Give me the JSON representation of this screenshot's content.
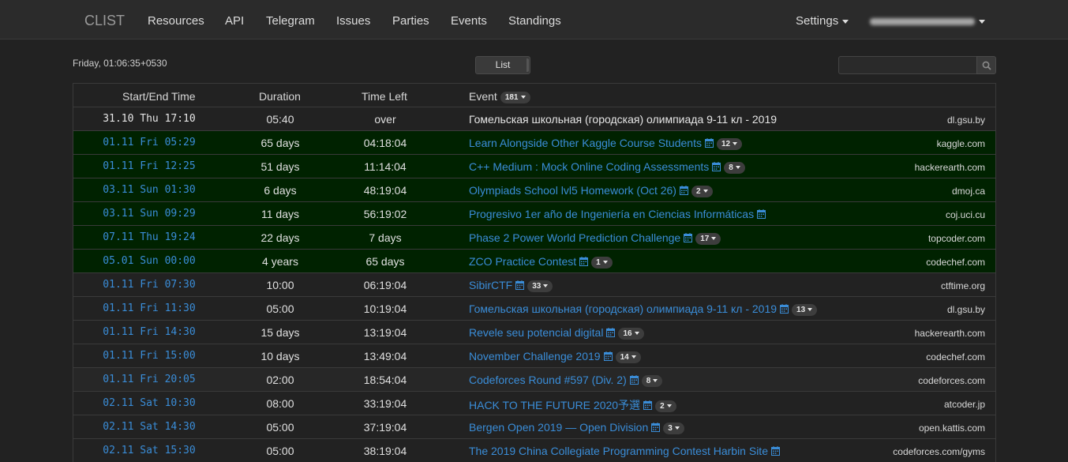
{
  "navbar": {
    "brand": "CLIST",
    "links": [
      "Resources",
      "API",
      "Telegram",
      "Issues",
      "Parties",
      "Events",
      "Standings"
    ],
    "settings_label": "Settings"
  },
  "toolbar": {
    "clock": "Friday, 01:06:35+0530",
    "view_label": "List",
    "search_placeholder": ""
  },
  "table": {
    "headers": {
      "start": "Start/End Time",
      "duration": "Duration",
      "time_left": "Time Left",
      "event": "Event",
      "event_count": "181"
    },
    "rows": [
      {
        "start": "31.10 Thu 17:10",
        "duration": "05:40",
        "left": "over",
        "title": "Гомельская школьная (городская) олимпиада 9-11 кл - 2019",
        "badge": "",
        "calendar": false,
        "host": "dl.gsu.by"
      },
      {
        "start": "01.11 Fri 05:29",
        "duration": "65 days",
        "left": "04:18:04",
        "title": "Learn Alongside Other Kaggle Course Students",
        "badge": "12",
        "calendar": true,
        "host": "kaggle.com"
      },
      {
        "start": "01.11 Fri 12:25",
        "duration": "51 days",
        "left": "11:14:04",
        "title": "C++ Medium : Mock Online Coding Assessments",
        "badge": "8",
        "calendar": true,
        "host": "hackerearth.com"
      },
      {
        "start": "03.11 Sun 01:30",
        "duration": "6 days",
        "left": "48:19:04",
        "title": "Olympiads School lvl5 Homework (Oct 26)",
        "badge": "2",
        "calendar": true,
        "host": "dmoj.ca"
      },
      {
        "start": "03.11 Sun 09:29",
        "duration": "11 days",
        "left": "56:19:02",
        "title": "Progresivo 1er año de Ingeniería en Ciencias Informáticas",
        "badge": "",
        "calendar": true,
        "host": "coj.uci.cu"
      },
      {
        "start": "07.11 Thu 19:24",
        "duration": "22 days",
        "left": "7 days",
        "title": "Phase 2 Power World Prediction Challenge",
        "badge": "17",
        "calendar": true,
        "host": "topcoder.com"
      },
      {
        "start": "05.01 Sun 00:00",
        "duration": "4 years",
        "left": "65 days",
        "title": "ZCO Practice Contest",
        "badge": "1",
        "calendar": true,
        "host": "codechef.com"
      },
      {
        "start": "01.11 Fri 07:30",
        "duration": "10:00",
        "left": "06:19:04",
        "title": "SibirCTF",
        "badge": "33",
        "calendar": true,
        "host": "ctftime.org"
      },
      {
        "start": "01.11 Fri 11:30",
        "duration": "05:00",
        "left": "10:19:04",
        "title": "Гомельская школьная (городская) олимпиада 9-11 кл - 2019",
        "badge": "13",
        "calendar": true,
        "host": "dl.gsu.by"
      },
      {
        "start": "01.11 Fri 14:30",
        "duration": "15 days",
        "left": "13:19:04",
        "title": "Revele seu potencial digital",
        "badge": "16",
        "calendar": true,
        "host": "hackerearth.com"
      },
      {
        "start": "01.11 Fri 15:00",
        "duration": "10 days",
        "left": "13:49:04",
        "title": "November Challenge 2019",
        "badge": "14",
        "calendar": true,
        "host": "codechef.com"
      },
      {
        "start": "01.11 Fri 20:05",
        "duration": "02:00",
        "left": "18:54:04",
        "title": "Codeforces Round #597 (Div. 2)",
        "badge": "8",
        "calendar": true,
        "host": "codeforces.com"
      },
      {
        "start": "02.11 Sat 10:30",
        "duration": "08:00",
        "left": "33:19:04",
        "title": "HACK TO THE FUTURE 2020予選",
        "badge": "2",
        "calendar": true,
        "host": "atcoder.jp"
      },
      {
        "start": "02.11 Sat 14:30",
        "duration": "05:00",
        "left": "37:19:04",
        "title": "Bergen Open 2019 — Open Division",
        "badge": "3",
        "calendar": true,
        "host": "open.kattis.com"
      },
      {
        "start": "02.11 Sat 15:30",
        "duration": "05:00",
        "left": "38:19:04",
        "title": "The 2019 China Collegiate Programming Contest Harbin Site",
        "badge": "",
        "calendar": true,
        "host": "codeforces.com/gyms"
      }
    ]
  },
  "colors": {
    "background": "#222222",
    "running_row": "#002200",
    "link": "#3a8dd8"
  }
}
